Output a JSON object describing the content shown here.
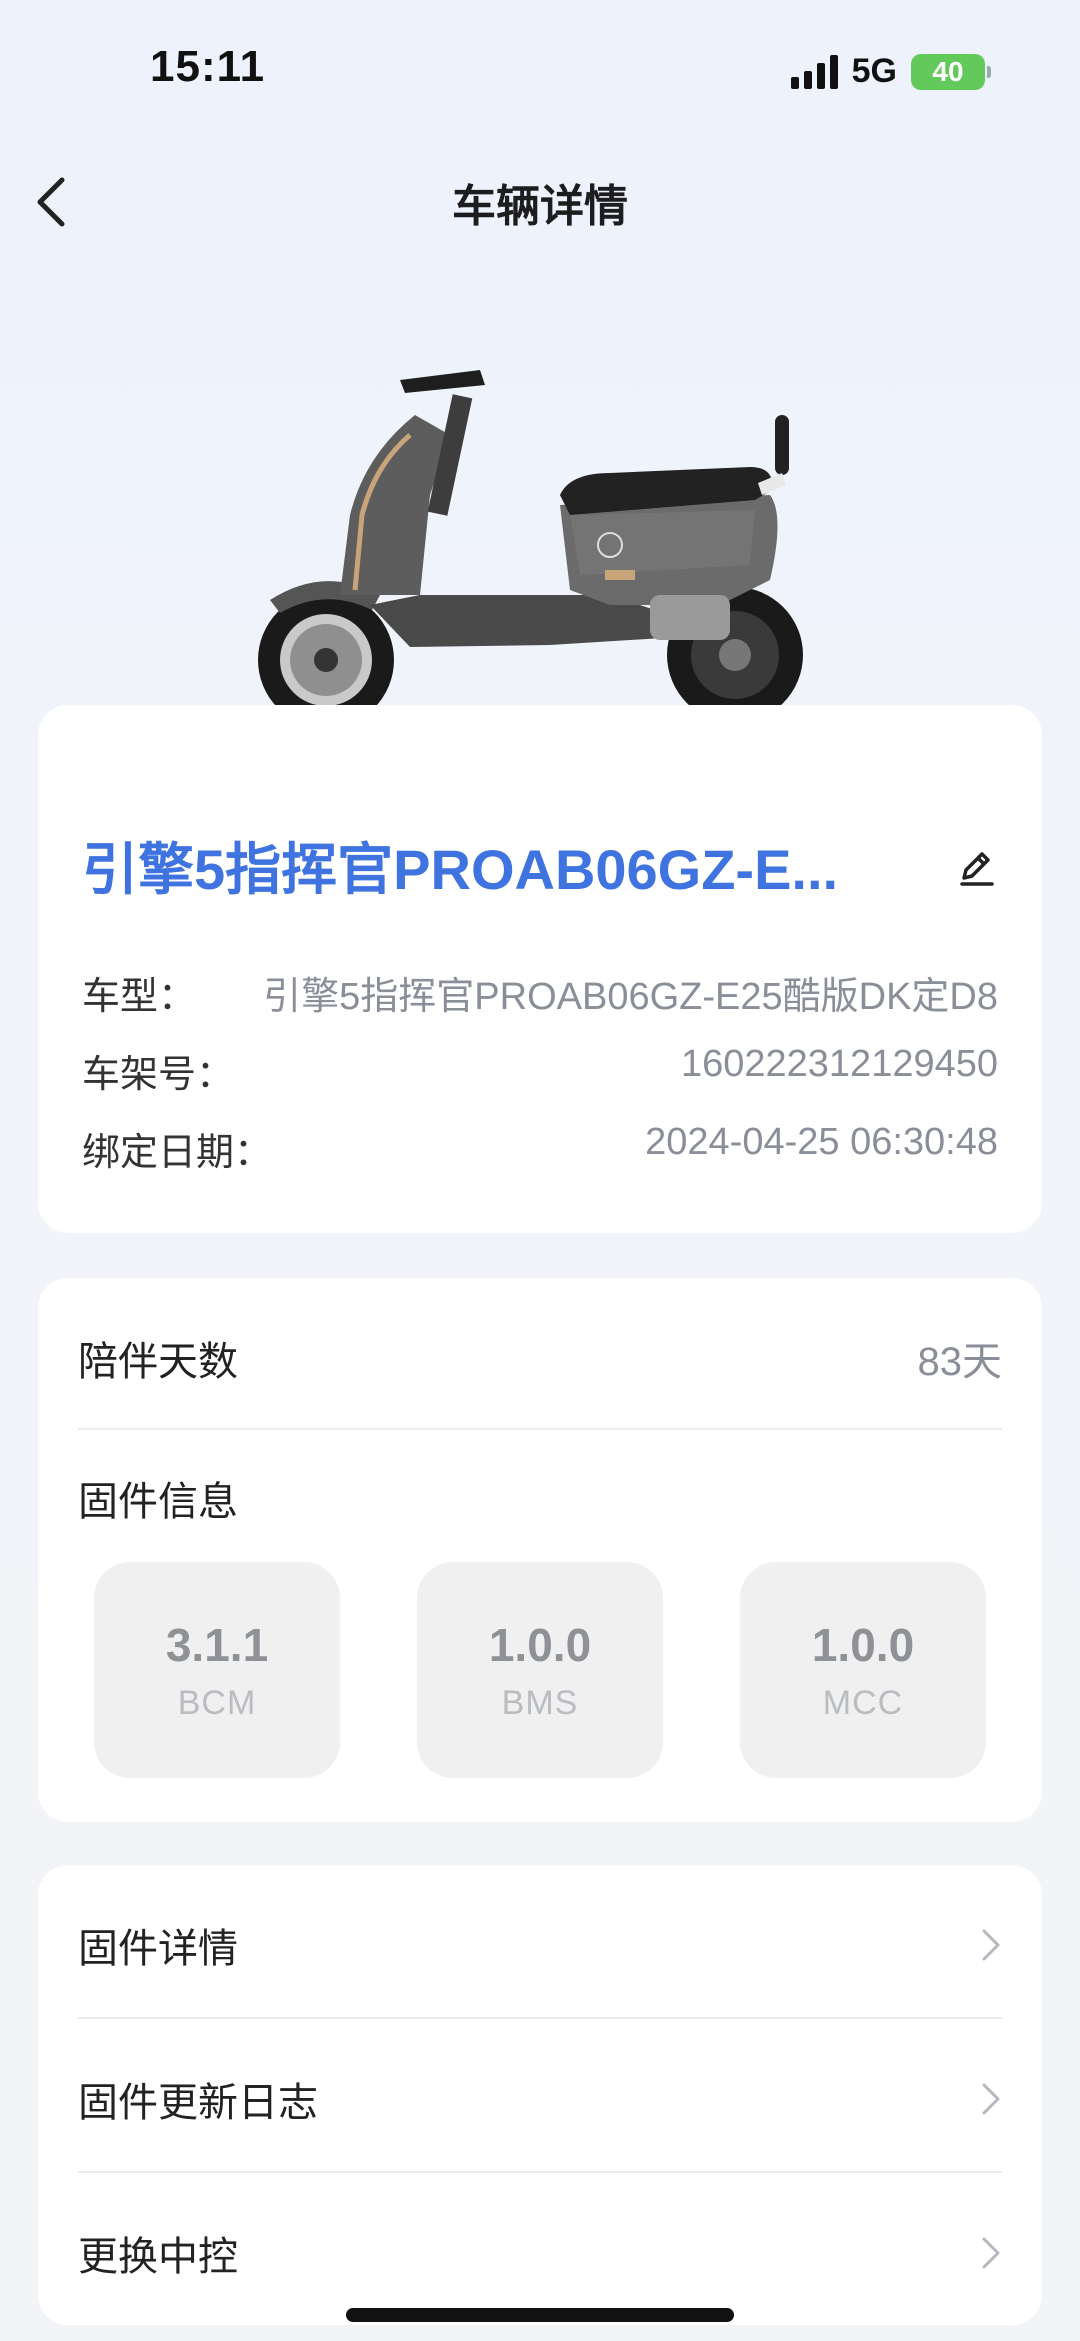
{
  "status_bar": {
    "time": "15:11",
    "network": "5G",
    "battery": "40"
  },
  "nav": {
    "title": "车辆详情",
    "back_icon": "chevron-left-icon"
  },
  "vehicle": {
    "name": "引擎5指挥官PROAB06GZ-E...",
    "edit_icon": "pencil-icon",
    "details": [
      {
        "label": "车型：",
        "value": "引擎5指挥官PROAB06GZ-E25酷版DK定D8"
      },
      {
        "label": "车架号：",
        "value": "160222312129450"
      },
      {
        "label": "绑定日期：",
        "value": "2024-04-25 06:30:48"
      }
    ]
  },
  "companion": {
    "label": "陪伴天数",
    "value": "83天"
  },
  "firmware": {
    "title": "固件信息",
    "items": [
      {
        "version": "3.1.1",
        "name": "BCM"
      },
      {
        "version": "1.0.0",
        "name": "BMS"
      },
      {
        "version": "1.0.0",
        "name": "MCC"
      }
    ]
  },
  "menu": [
    {
      "label": "固件详情"
    },
    {
      "label": "固件更新日志"
    },
    {
      "label": "更换中控"
    }
  ],
  "colors": {
    "accent": "#3f73e0",
    "battery": "#62c95a"
  }
}
